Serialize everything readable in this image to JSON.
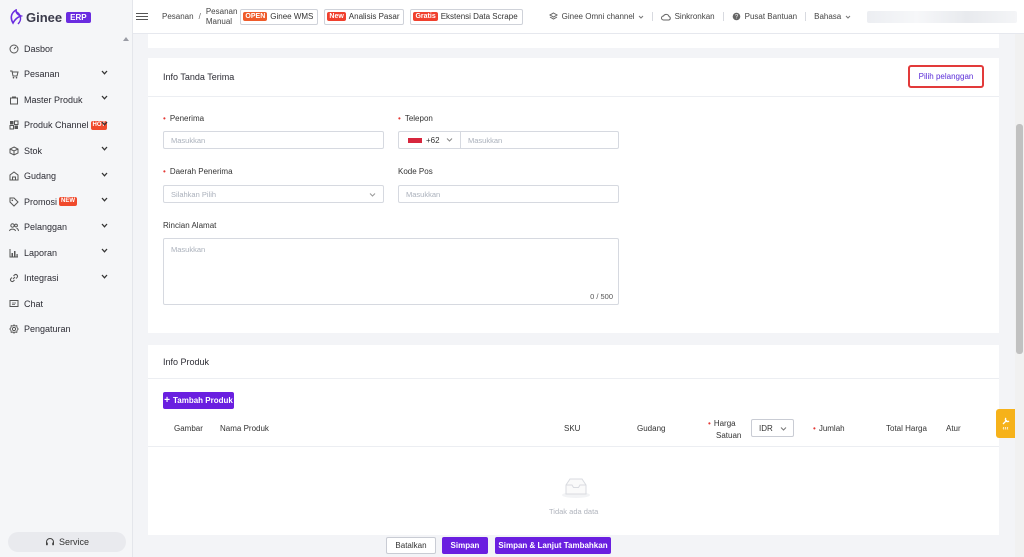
{
  "app": {
    "logo_text": "Ginee",
    "logo_badge": "ERP"
  },
  "sidebar": {
    "items": [
      {
        "label": "Dasbor",
        "icon": "dashboard-icon",
        "chevron": false
      },
      {
        "label": "Pesanan",
        "icon": "cart-icon",
        "chevron": true
      },
      {
        "label": "Master Produk",
        "icon": "bag-icon",
        "chevron": true
      },
      {
        "label": "Produk Channel",
        "icon": "channel-icon",
        "chevron": true,
        "badge": "HOT"
      },
      {
        "label": "Stok",
        "icon": "box-icon",
        "chevron": true
      },
      {
        "label": "Gudang",
        "icon": "warehouse-icon",
        "chevron": true
      },
      {
        "label": "Promosi",
        "icon": "tag-icon",
        "chevron": true,
        "badge": "NEW"
      },
      {
        "label": "Pelanggan",
        "icon": "users-icon",
        "chevron": true
      },
      {
        "label": "Laporan",
        "icon": "chart-icon",
        "chevron": true
      },
      {
        "label": "Integrasi",
        "icon": "link-icon",
        "chevron": true
      },
      {
        "label": "Chat",
        "icon": "chat-icon",
        "chevron": false
      },
      {
        "label": "Pengaturan",
        "icon": "gear-icon",
        "chevron": false
      }
    ],
    "service_label": "Service"
  },
  "topbar": {
    "breadcrumb_1": "Pesanan",
    "breadcrumb_sep": "/",
    "breadcrumb_2a": "Pesanan",
    "breadcrumb_2b": "Manual",
    "promo_1_pill": "OPEN",
    "promo_1_label": "Ginee WMS",
    "promo_2_pill": "New",
    "promo_2_label": "Analisis Pasar",
    "promo_3_pill": "Gratis",
    "promo_3_label": "Ekstensi Data Scrape",
    "omni_channel": "Ginee Omni channel",
    "sync": "Sinkronkan",
    "help": "Pusat Bantuan",
    "language": "Bahasa"
  },
  "receipt": {
    "title": "Info Tanda Terima",
    "pick_customer": "Pilih pelanggan",
    "recipient_label": "Penerima",
    "recipient_placeholder": "Masukkan",
    "phone_label": "Telepon",
    "phone_code": "+62",
    "phone_placeholder": "Masukkan",
    "region_label": "Daerah Penerima",
    "region_placeholder": "Silahkan Pilih",
    "postcode_label": "Kode Pos",
    "postcode_placeholder": "Masukkan",
    "address_label": "Rincian Alamat",
    "address_placeholder": "Masukkan",
    "address_counter": "0 / 500"
  },
  "product": {
    "title": "Info Produk",
    "add_button": "Tambah Produk",
    "columns": {
      "image": "Gambar",
      "name": "Nama Produk",
      "sku": "SKU",
      "warehouse": "Gudang",
      "unit_price_1": "Harga",
      "unit_price_2": "Satuan",
      "currency": "IDR",
      "qty": "Jumlah",
      "total": "Total Harga",
      "action": "Atur"
    },
    "empty_text": "Tidak ada data"
  },
  "footer": {
    "cancel": "Batalkan",
    "save": "Simpan",
    "save_more": "Simpan & Lanjut Tambahkan"
  },
  "colors": {
    "primary": "#6a1fe0",
    "highlight_border": "#e23a3a",
    "required": "#e53935"
  }
}
